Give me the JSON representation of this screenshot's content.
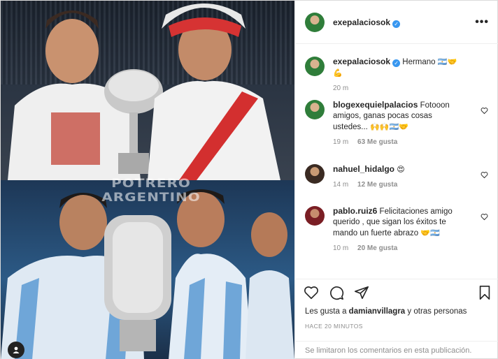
{
  "photo": {
    "watermark": "POTRERO ARGENTINO"
  },
  "header": {
    "username": "exepalaciosok",
    "more_label": "•••"
  },
  "caption": {
    "username": "exepalaciosok",
    "text": "Hermano",
    "emojis": "🇦🇷🤝💪",
    "time": "20 m"
  },
  "comments": [
    {
      "username": "blogexequielpalacios",
      "text": "Fotooon amigos, ganas pocas cosas ustedes...",
      "emojis": "🙌🙌🇦🇷🤝",
      "time": "19 m",
      "likes": "63 Me gusta"
    },
    {
      "username": "nahuel_hidalgo",
      "text": "",
      "emojis": "😍",
      "time": "14 m",
      "likes": "12 Me gusta"
    },
    {
      "username": "pablo.ruiz6",
      "text": "Felicitaciones amigo querido , que sigan los éxitos te mando un fuerte abrazo",
      "emojis": "🤝🇦🇷",
      "time": "10 m",
      "likes": "20 Me gusta"
    }
  ],
  "likes": {
    "prefix": "Les gusta a",
    "user": "damianvillagra",
    "suffix": "y otras personas"
  },
  "time_ago": "HACE 20 MINUTOS",
  "comments_limited": "Se limitaron los comentarios en esta publicación.",
  "icons": {
    "verified": "verified-badge-icon",
    "like": "heart-icon",
    "comment": "comment-icon",
    "share": "share-icon",
    "save": "bookmark-icon",
    "user_tag": "person-icon"
  },
  "colors": {
    "verified": "#3897f0",
    "secondary_text": "#8e8e8e",
    "border": "#dbdbdb"
  }
}
